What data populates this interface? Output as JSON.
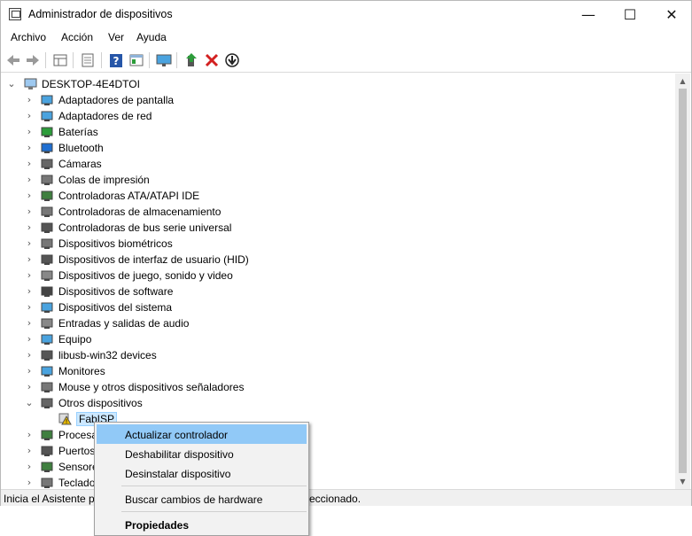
{
  "window": {
    "title": "Administrador de dispositivos",
    "minimize": "—",
    "maximize": "☐",
    "close": "✕"
  },
  "menu": [
    "Archivo",
    "Acción",
    "Ver",
    "Ayuda"
  ],
  "toolbar": {
    "buttons": [
      "back",
      "forward",
      "properties-view",
      "list-view",
      "help",
      "device-props",
      "monitor",
      "enable-device",
      "uninstall",
      "download"
    ],
    "icons": [
      "arrow-left-icon",
      "arrow-right-icon",
      "grid-icon",
      "list-icon",
      "help-icon",
      "props-icon",
      "monitor-icon",
      "update-driver-icon",
      "delete-icon",
      "download-icon"
    ],
    "colors": {
      "help": "#2656a8",
      "delete": "#d32020",
      "green": "#2c9c3a"
    }
  },
  "tree": {
    "root": "DESKTOP-4E4DTOI",
    "categories": [
      {
        "label": "Adaptadores de pantalla",
        "icon": "display-adapter-icon"
      },
      {
        "label": "Adaptadores de red",
        "icon": "network-adapter-icon"
      },
      {
        "label": "Baterías",
        "icon": "battery-icon"
      },
      {
        "label": "Bluetooth",
        "icon": "bluetooth-icon"
      },
      {
        "label": "Cámaras",
        "icon": "camera-icon"
      },
      {
        "label": "Colas de impresión",
        "icon": "printer-icon"
      },
      {
        "label": "Controladoras ATA/ATAPI IDE",
        "icon": "ide-controller-icon"
      },
      {
        "label": "Controladoras de almacenamiento",
        "icon": "storage-controller-icon"
      },
      {
        "label": "Controladoras de bus serie universal",
        "icon": "usb-icon"
      },
      {
        "label": "Dispositivos biométricos",
        "icon": "fingerprint-icon"
      },
      {
        "label": "Dispositivos de interfaz de usuario (HID)",
        "icon": "hid-icon"
      },
      {
        "label": "Dispositivos de juego, sonido y video",
        "icon": "speaker-icon"
      },
      {
        "label": "Dispositivos de software",
        "icon": "software-device-icon"
      },
      {
        "label": "Dispositivos del sistema",
        "icon": "system-device-icon"
      },
      {
        "label": "Entradas y salidas de audio",
        "icon": "audio-icon"
      },
      {
        "label": "Equipo",
        "icon": "computer-icon"
      },
      {
        "label": "libusb-win32 devices",
        "icon": "usb-device-icon"
      },
      {
        "label": "Monitores",
        "icon": "monitor-icon"
      },
      {
        "label": "Mouse y otros dispositivos señaladores",
        "icon": "mouse-icon"
      },
      {
        "label": "Otros dispositivos",
        "icon": "unknown-device-icon",
        "expanded": true
      },
      {
        "label": "FabISP",
        "icon": "warning-device-icon",
        "child": true,
        "selected": true
      },
      {
        "label": "Procesa",
        "icon": "processor-icon"
      },
      {
        "label": "Puertos",
        "icon": "port-icon"
      },
      {
        "label": "Sensore",
        "icon": "sensor-icon"
      },
      {
        "label": "Teclado",
        "icon": "keyboard-icon"
      }
    ]
  },
  "status": {
    "left": "Inicia el Asistente pa",
    "right": "eccionado."
  },
  "context_menu": {
    "items": [
      {
        "label": "Actualizar controlador",
        "highlighted": true
      },
      {
        "label": "Deshabilitar dispositivo"
      },
      {
        "label": "Desinstalar dispositivo"
      },
      {
        "separator": true
      },
      {
        "label": "Buscar cambios de hardware"
      },
      {
        "separator": true
      },
      {
        "label": "Propiedades",
        "bold": true
      }
    ]
  }
}
